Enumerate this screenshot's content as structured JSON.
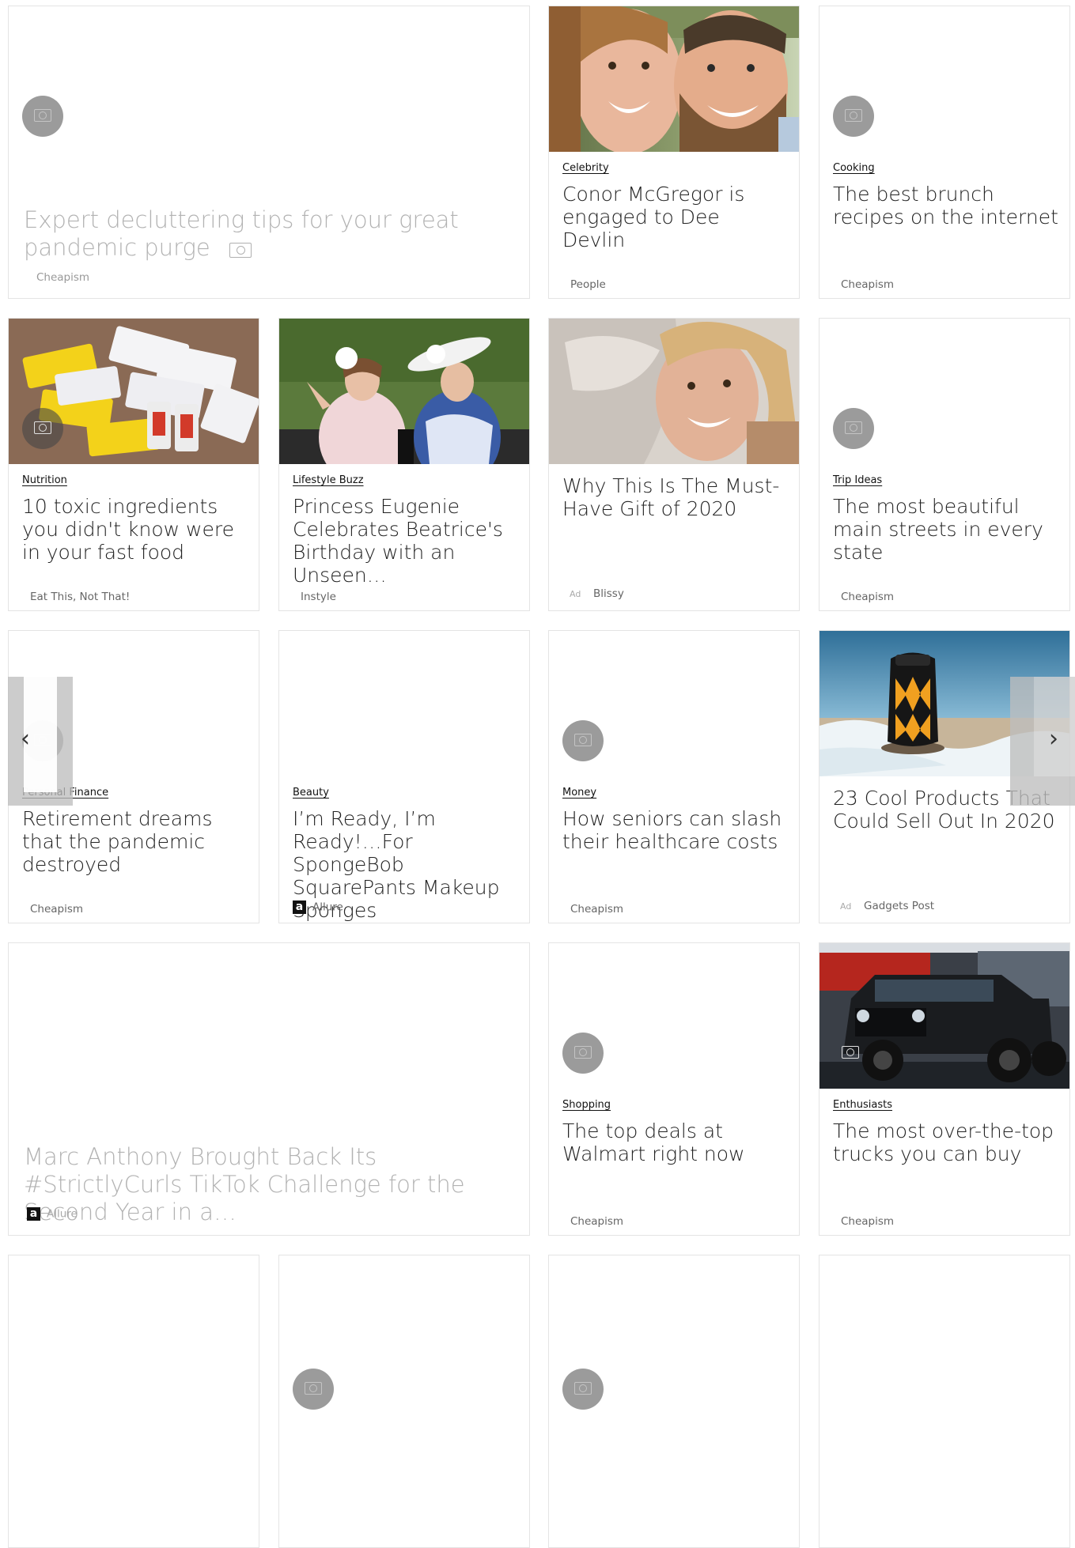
{
  "cards": {
    "declutter": {
      "title": "Expert decluttering tips for your great pandemic purge",
      "source": "Cheapism"
    },
    "mcgregor": {
      "category": "Celebrity",
      "title": "Conor McGregor is engaged to Dee Devlin",
      "source": "People"
    },
    "brunch": {
      "category": "Cooking",
      "title": "The best brunch recipes on the internet",
      "source": "Cheapism"
    },
    "toxic": {
      "category": "Nutrition",
      "title": "10 toxic ingredients you didn't know were in your fast food",
      "source": "Eat This, Not That!"
    },
    "eugenie": {
      "category": "Lifestyle Buzz",
      "title": "Princess Eugenie Celebrates Beatrice's Birthday with an Unseen…",
      "source": "Instyle"
    },
    "blissy": {
      "title": "Why This Is The Must-Have Gift of 2020",
      "ad_label": "Ad",
      "source": "Blissy"
    },
    "streets": {
      "category": "Trip Ideas",
      "title": "The most beautiful main streets in every state",
      "source": "Cheapism"
    },
    "retirement": {
      "category": "Personal Finance",
      "title": "Retirement dreams that the pandemic destroyed",
      "source": "Cheapism"
    },
    "spongebob": {
      "category": "Beauty",
      "title": "I’m Ready, I’m Ready!…For SpongeBob SquarePants Makeup Sponges",
      "source": "Allure",
      "logo": "a"
    },
    "seniors": {
      "category": "Money",
      "title": "How seniors can slash their healthcare costs",
      "source": "Cheapism"
    },
    "gadgets": {
      "title": "23 Cool Products That Could Sell Out In 2020",
      "ad_label": "Ad",
      "source": "Gadgets Post"
    },
    "marc": {
      "title": "Marc Anthony Brought Back Its #StrictlyCurls TikTok Challenge for the Second Year in a…",
      "source": "Allure",
      "logo": "a"
    },
    "walmart": {
      "category": "Shopping",
      "title": "The top deals at Walmart right now",
      "source": "Cheapism"
    },
    "trucks": {
      "category": "Enthusiasts",
      "title": "The most over-the-top trucks you can buy",
      "source": "Cheapism"
    }
  },
  "nav": {
    "prev": "‹",
    "next": "›"
  },
  "icons": {
    "camera": "camera-icon",
    "prev": "chevron-left-icon",
    "next": "chevron-right-icon",
    "allure_logo": "allure-logo-icon"
  }
}
